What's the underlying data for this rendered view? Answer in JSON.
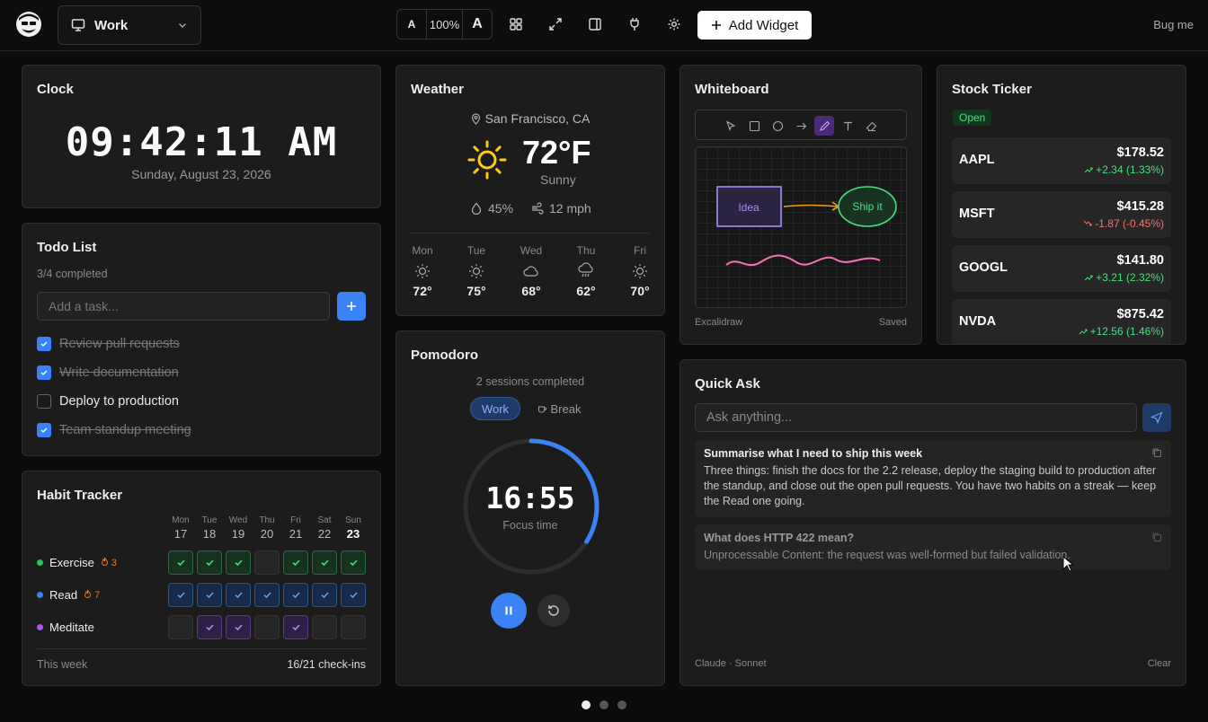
{
  "topbar": {
    "workspace": "Work",
    "zoom_small": "A",
    "zoom_value": "100%",
    "zoom_big": "A",
    "add_widget": "Add Widget",
    "bug": "Bug me"
  },
  "clock": {
    "title": "Clock",
    "time": "09:42:11 AM",
    "date": "Sunday, August 23, 2026"
  },
  "todo": {
    "title": "Todo List",
    "progress": "3/4 completed",
    "placeholder": "Add a task...",
    "items": [
      {
        "label": "Review pull requests",
        "done": true
      },
      {
        "label": "Write documentation",
        "done": true
      },
      {
        "label": "Deploy to production",
        "done": false
      },
      {
        "label": "Team standup meeting",
        "done": true
      }
    ]
  },
  "habits": {
    "title": "Habit Tracker",
    "days": [
      {
        "d": "Mon",
        "n": "17"
      },
      {
        "d": "Tue",
        "n": "18"
      },
      {
        "d": "Wed",
        "n": "19"
      },
      {
        "d": "Thu",
        "n": "20"
      },
      {
        "d": "Fri",
        "n": "21"
      },
      {
        "d": "Sat",
        "n": "22"
      },
      {
        "d": "Sun",
        "n": "23"
      }
    ],
    "rows": [
      {
        "name": "Exercise",
        "streak": "3",
        "color": "#22c55e",
        "checks": [
          1,
          1,
          1,
          0,
          1,
          1,
          1
        ]
      },
      {
        "name": "Read",
        "streak": "7",
        "color": "#3b82f6",
        "checks": [
          1,
          1,
          1,
          1,
          1,
          1,
          1
        ]
      },
      {
        "name": "Meditate",
        "streak": "",
        "color": "#a855f7",
        "checks": [
          0,
          1,
          1,
          0,
          1,
          0,
          0
        ]
      }
    ],
    "footer_left": "This week",
    "footer_right": "16/21 check-ins"
  },
  "weather": {
    "title": "Weather",
    "location": "San Francisco, CA",
    "temp": "72°F",
    "condition": "Sunny",
    "humidity": "45%",
    "wind": "12 mph",
    "forecast": [
      {
        "day": "Mon",
        "temp": "72°",
        "icon": "sun-icon"
      },
      {
        "day": "Tue",
        "temp": "75°",
        "icon": "sun-icon"
      },
      {
        "day": "Wed",
        "temp": "68°",
        "icon": "cloud-icon"
      },
      {
        "day": "Thu",
        "temp": "62°",
        "icon": "rain-icon"
      },
      {
        "day": "Fri",
        "temp": "70°",
        "icon": "sun-icon"
      }
    ]
  },
  "pomodoro": {
    "title": "Pomodoro",
    "sessions": "2 sessions completed",
    "mode_work": "Work",
    "mode_break": "Break",
    "time": "16:55",
    "label": "Focus time",
    "progress": 0.34
  },
  "whiteboard": {
    "title": "Whiteboard",
    "box_label": "Idea",
    "ellipse_label": "Ship it",
    "footer_left": "Excalidraw",
    "footer_right": "Saved"
  },
  "stocks": {
    "title": "Stock Ticker",
    "status": "Open",
    "rows": [
      {
        "sym": "AAPL",
        "price": "$178.52",
        "chg": "+2.34 (1.33%)",
        "up": true
      },
      {
        "sym": "MSFT",
        "price": "$415.28",
        "chg": "-1.87 (-0.45%)",
        "up": false
      },
      {
        "sym": "GOOGL",
        "price": "$141.80",
        "chg": "+3.21 (2.32%)",
        "up": true
      },
      {
        "sym": "NVDA",
        "price": "$875.42",
        "chg": "+12.56 (1.46%)",
        "up": true
      }
    ]
  },
  "quickask": {
    "title": "Quick Ask",
    "placeholder": "Ask anything...",
    "items": [
      {
        "q": "Summarise what I need to ship this week",
        "a": "Three things: finish the docs for the 2.2 release, deploy the staging build to production after the standup, and close out the open pull requests. You have two habits on a streak — keep the Read one going."
      },
      {
        "q": "What does HTTP 422 mean?",
        "a": "Unprocessable Content: the request was well-formed but failed validation."
      }
    ],
    "model": "Claude · Sonnet",
    "clear": "Clear"
  }
}
